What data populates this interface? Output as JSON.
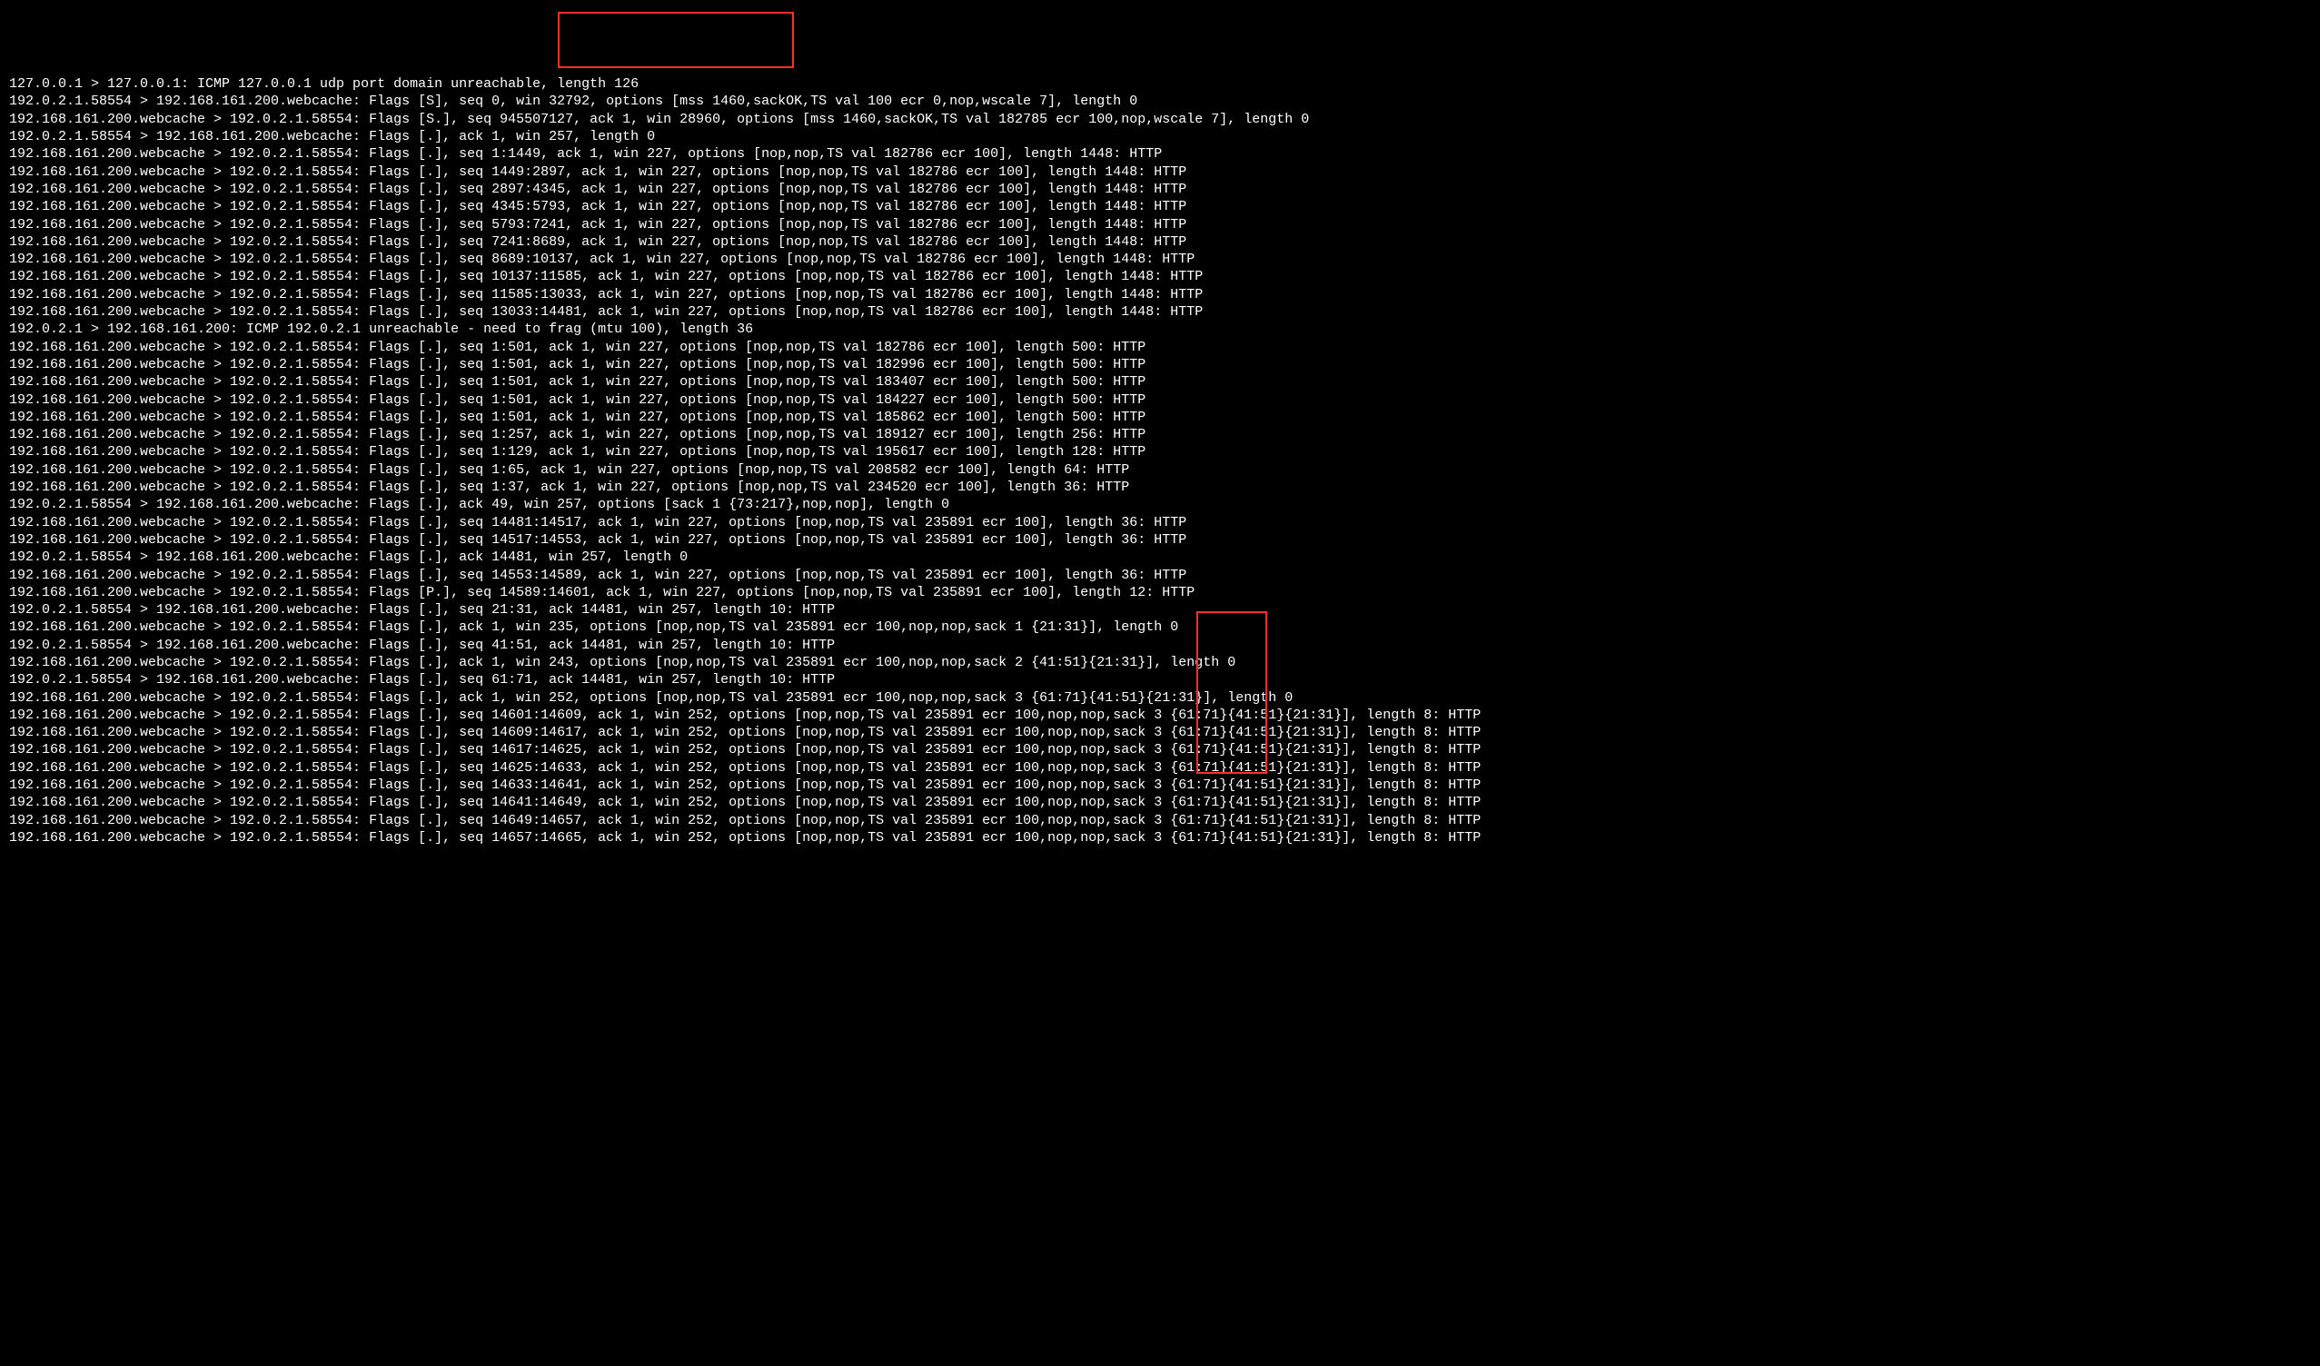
{
  "watermark": "",
  "lines": [
    "127.0.0.1 > 127.0.0.1: ICMP 127.0.0.1 udp port domain unreachable, length 126",
    "192.0.2.1.58554 > 192.168.161.200.webcache: Flags [S], seq 0, win 32792, options [mss 1460,sackOK,TS val 100 ecr 0,nop,wscale 7], length 0",
    "192.168.161.200.webcache > 192.0.2.1.58554: Flags [S.], seq 945507127, ack 1, win 28960, options [mss 1460,sackOK,TS val 182785 ecr 100,nop,wscale 7], length 0",
    "192.0.2.1.58554 > 192.168.161.200.webcache: Flags [.], ack 1, win 257, length 0",
    "192.168.161.200.webcache > 192.0.2.1.58554: Flags [.], seq 1:1449, ack 1, win 227, options [nop,nop,TS val 182786 ecr 100], length 1448: HTTP",
    "192.168.161.200.webcache > 192.0.2.1.58554: Flags [.], seq 1449:2897, ack 1, win 227, options [nop,nop,TS val 182786 ecr 100], length 1448: HTTP",
    "192.168.161.200.webcache > 192.0.2.1.58554: Flags [.], seq 2897:4345, ack 1, win 227, options [nop,nop,TS val 182786 ecr 100], length 1448: HTTP",
    "192.168.161.200.webcache > 192.0.2.1.58554: Flags [.], seq 4345:5793, ack 1, win 227, options [nop,nop,TS val 182786 ecr 100], length 1448: HTTP",
    "192.168.161.200.webcache > 192.0.2.1.58554: Flags [.], seq 5793:7241, ack 1, win 227, options [nop,nop,TS val 182786 ecr 100], length 1448: HTTP",
    "192.168.161.200.webcache > 192.0.2.1.58554: Flags [.], seq 7241:8689, ack 1, win 227, options [nop,nop,TS val 182786 ecr 100], length 1448: HTTP",
    "192.168.161.200.webcache > 192.0.2.1.58554: Flags [.], seq 8689:10137, ack 1, win 227, options [nop,nop,TS val 182786 ecr 100], length 1448: HTTP",
    "192.168.161.200.webcache > 192.0.2.1.58554: Flags [.], seq 10137:11585, ack 1, win 227, options [nop,nop,TS val 182786 ecr 100], length 1448: HTTP",
    "192.168.161.200.webcache > 192.0.2.1.58554: Flags [.], seq 11585:13033, ack 1, win 227, options [nop,nop,TS val 182786 ecr 100], length 1448: HTTP",
    "192.168.161.200.webcache > 192.0.2.1.58554: Flags [.], seq 13033:14481, ack 1, win 227, options [nop,nop,TS val 182786 ecr 100], length 1448: HTTP",
    "192.0.2.1 > 192.168.161.200: ICMP 192.0.2.1 unreachable - need to frag (mtu 100), length 36",
    "192.168.161.200.webcache > 192.0.2.1.58554: Flags [.], seq 1:501, ack 1, win 227, options [nop,nop,TS val 182786 ecr 100], length 500: HTTP",
    "192.168.161.200.webcache > 192.0.2.1.58554: Flags [.], seq 1:501, ack 1, win 227, options [nop,nop,TS val 182996 ecr 100], length 500: HTTP",
    "192.168.161.200.webcache > 192.0.2.1.58554: Flags [.], seq 1:501, ack 1, win 227, options [nop,nop,TS val 183407 ecr 100], length 500: HTTP",
    "192.168.161.200.webcache > 192.0.2.1.58554: Flags [.], seq 1:501, ack 1, win 227, options [nop,nop,TS val 184227 ecr 100], length 500: HTTP",
    "192.168.161.200.webcache > 192.0.2.1.58554: Flags [.], seq 1:501, ack 1, win 227, options [nop,nop,TS val 185862 ecr 100], length 500: HTTP",
    "192.168.161.200.webcache > 192.0.2.1.58554: Flags [.], seq 1:257, ack 1, win 227, options [nop,nop,TS val 189127 ecr 100], length 256: HTTP",
    "192.168.161.200.webcache > 192.0.2.1.58554: Flags [.], seq 1:129, ack 1, win 227, options [nop,nop,TS val 195617 ecr 100], length 128: HTTP",
    "192.168.161.200.webcache > 192.0.2.1.58554: Flags [.], seq 1:65, ack 1, win 227, options [nop,nop,TS val 208582 ecr 100], length 64: HTTP",
    "192.168.161.200.webcache > 192.0.2.1.58554: Flags [.], seq 1:37, ack 1, win 227, options [nop,nop,TS val 234520 ecr 100], length 36: HTTP",
    "192.0.2.1.58554 > 192.168.161.200.webcache: Flags [.], ack 49, win 257, options [sack 1 {73:217},nop,nop], length 0",
    "192.168.161.200.webcache > 192.0.2.1.58554: Flags [.], seq 14481:14517, ack 1, win 227, options [nop,nop,TS val 235891 ecr 100], length 36: HTTP",
    "192.168.161.200.webcache > 192.0.2.1.58554: Flags [.], seq 14517:14553, ack 1, win 227, options [nop,nop,TS val 235891 ecr 100], length 36: HTTP",
    "192.0.2.1.58554 > 192.168.161.200.webcache: Flags [.], ack 14481, win 257, length 0",
    "192.168.161.200.webcache > 192.0.2.1.58554: Flags [.], seq 14553:14589, ack 1, win 227, options [nop,nop,TS val 235891 ecr 100], length 36: HTTP",
    "192.168.161.200.webcache > 192.0.2.1.58554: Flags [P.], seq 14589:14601, ack 1, win 227, options [nop,nop,TS val 235891 ecr 100], length 12: HTTP",
    "192.0.2.1.58554 > 192.168.161.200.webcache: Flags [.], seq 21:31, ack 14481, win 257, length 10: HTTP",
    "192.168.161.200.webcache > 192.0.2.1.58554: Flags [.], ack 1, win 235, options [nop,nop,TS val 235891 ecr 100,nop,nop,sack 1 {21:31}], length 0",
    "192.0.2.1.58554 > 192.168.161.200.webcache: Flags [.], seq 41:51, ack 14481, win 257, length 10: HTTP",
    "192.168.161.200.webcache > 192.0.2.1.58554: Flags [.], ack 1, win 243, options [nop,nop,TS val 235891 ecr 100,nop,nop,sack 2 {41:51}{21:31}], length 0",
    "192.0.2.1.58554 > 192.168.161.200.webcache: Flags [.], seq 61:71, ack 14481, win 257, length 10: HTTP",
    "192.168.161.200.webcache > 192.0.2.1.58554: Flags [.], ack 1, win 252, options [nop,nop,TS val 235891 ecr 100,nop,nop,sack 3 {61:71}{41:51}{21:31}], length 0",
    "192.168.161.200.webcache > 192.0.2.1.58554: Flags [.], seq 14601:14609, ack 1, win 252, options [nop,nop,TS val 235891 ecr 100,nop,nop,sack 3 {61:71}{41:51}{21:31}], length 8: HTTP",
    "192.168.161.200.webcache > 192.0.2.1.58554: Flags [.], seq 14609:14617, ack 1, win 252, options [nop,nop,TS val 235891 ecr 100,nop,nop,sack 3 {61:71}{41:51}{21:31}], length 8: HTTP",
    "192.168.161.200.webcache > 192.0.2.1.58554: Flags [.], seq 14617:14625, ack 1, win 252, options [nop,nop,TS val 235891 ecr 100,nop,nop,sack 3 {61:71}{41:51}{21:31}], length 8: HTTP",
    "192.168.161.200.webcache > 192.0.2.1.58554: Flags [.], seq 14625:14633, ack 1, win 252, options [nop,nop,TS val 235891 ecr 100,nop,nop,sack 3 {61:71}{41:51}{21:31}], length 8: HTTP",
    "192.168.161.200.webcache > 192.0.2.1.58554: Flags [.], seq 14633:14641, ack 1, win 252, options [nop,nop,TS val 235891 ecr 100,nop,nop,sack 3 {61:71}{41:51}{21:31}], length 8: HTTP",
    "192.168.161.200.webcache > 192.0.2.1.58554: Flags [.], seq 14641:14649, ack 1, win 252, options [nop,nop,TS val 235891 ecr 100,nop,nop,sack 3 {61:71}{41:51}{21:31}], length 8: HTTP",
    "192.168.161.200.webcache > 192.0.2.1.58554: Flags [.], seq 14649:14657, ack 1, win 252, options [nop,nop,TS val 235891 ecr 100,nop,nop,sack 3 {61:71}{41:51}{21:31}], length 8: HTTP",
    "192.168.161.200.webcache > 192.0.2.1.58554: Flags [.], seq 14657:14665, ack 1, win 252, options [nop,nop,TS val 235891 ecr 100,nop,nop,sack 3 {61:71}{41:51}{21:31}], length 8: HTTP"
  ]
}
